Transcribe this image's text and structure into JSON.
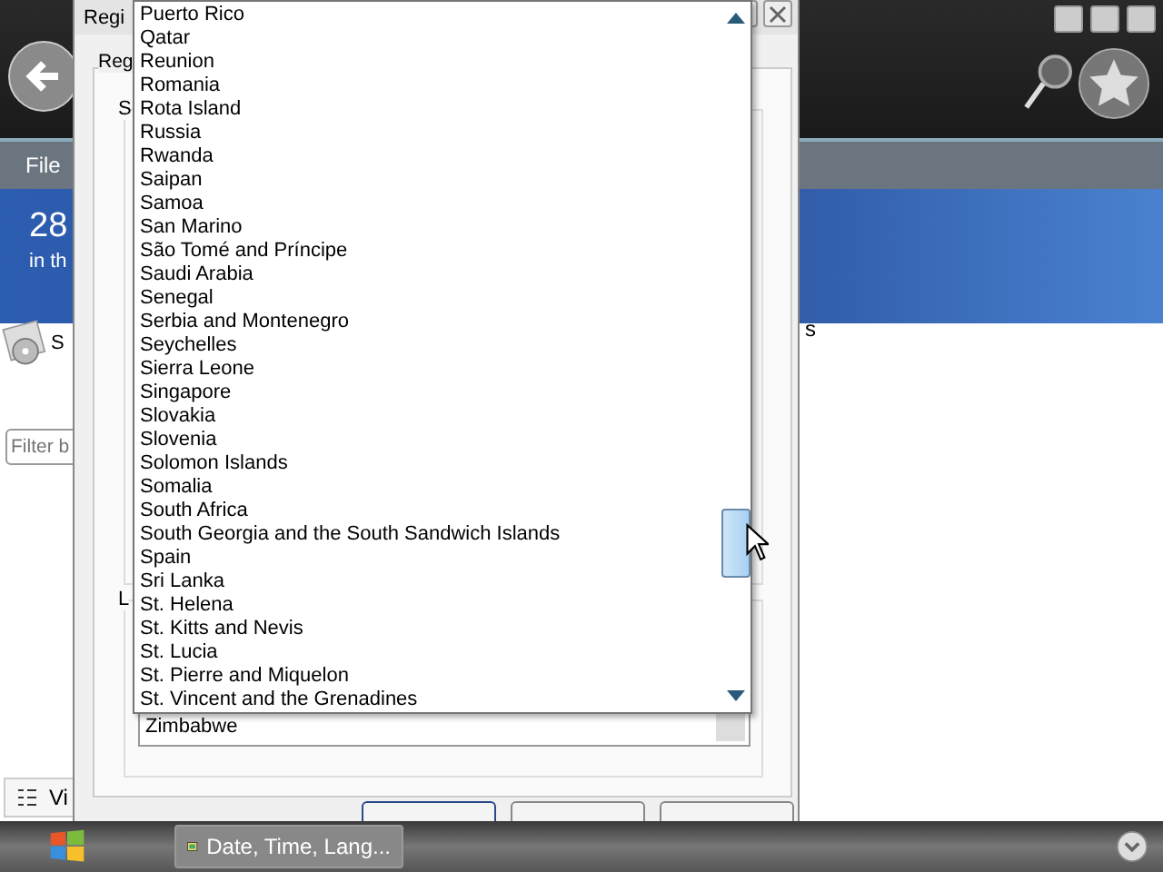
{
  "background_app": {
    "menu": [
      "File"
    ],
    "banner": {
      "title": "28",
      "subtitle": "in th"
    },
    "side_item": "S",
    "filter": {
      "placeholder": "Filter b"
    },
    "view_button": "Vi",
    "column_text": "s"
  },
  "dialog": {
    "title": "Regi",
    "tab": "Reg",
    "group_1": "S",
    "group_2": "L",
    "combo": {
      "value": "Zimbabwe"
    },
    "buttons": [
      {
        "kind": "default"
      },
      {
        "kind": "normal"
      },
      {
        "kind": "normal"
      }
    ]
  },
  "dropdown": {
    "items": [
      "Puerto Rico",
      "Qatar",
      "Reunion",
      "Romania",
      "Rota Island",
      "Russia",
      "Rwanda",
      "Saipan",
      "Samoa",
      "San Marino",
      "São Tomé and Príncipe",
      "Saudi Arabia",
      "Senegal",
      "Serbia and Montenegro",
      "Seychelles",
      "Sierra Leone",
      "Singapore",
      "Slovakia",
      "Slovenia",
      "Solomon Islands",
      "Somalia",
      "South Africa",
      "South Georgia and the South Sandwich Islands",
      "Spain",
      "Sri Lanka",
      "St. Helena",
      "St. Kitts and Nevis",
      "St. Lucia",
      "St. Pierre and Miquelon",
      "St. Vincent and the Grenadines"
    ]
  },
  "taskbar": {
    "tasks": [
      {
        "label": "Date, Time, Lang...",
        "selected": true
      }
    ]
  }
}
